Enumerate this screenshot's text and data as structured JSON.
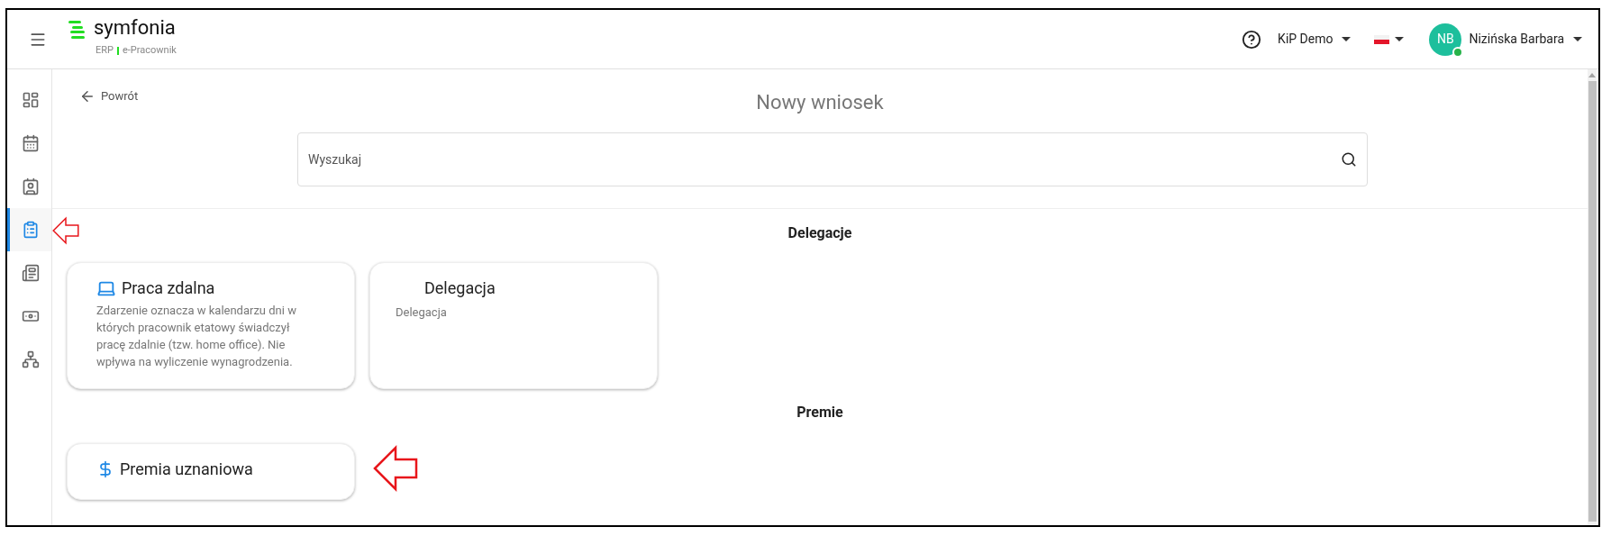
{
  "header": {
    "brand": "symfonia",
    "product_line": "ERP",
    "product": "e-Pracownik",
    "company": "KiP Demo",
    "user": {
      "initials": "NB",
      "name": "Nizińska Barbara",
      "online": true
    }
  },
  "sidebar": {
    "items": [
      {
        "kind": "dashboard",
        "selected": false
      },
      {
        "kind": "calendar",
        "selected": false
      },
      {
        "kind": "badge",
        "selected": false
      },
      {
        "kind": "clipboard",
        "selected": true
      },
      {
        "kind": "documents",
        "selected": false
      },
      {
        "kind": "money",
        "selected": false
      },
      {
        "kind": "org",
        "selected": false
      }
    ]
  },
  "page": {
    "back": "Powrót",
    "title": "Nowy wniosek",
    "search": {
      "placeholder": "Wyszukaj"
    }
  },
  "sections": [
    {
      "title": "Delegacje",
      "cards": [
        {
          "kind": "remote",
          "title": "Praca zdalna",
          "description": "Zdarzenie oznacza w kalendarzu dni w których pracownik etatowy świadczył pracę zdalnie (tzw. home office). Nie wpływa na wyliczenie wynagrodzenia."
        },
        {
          "kind": "travel",
          "title": "Delegacja",
          "description": "Delegacja"
        }
      ]
    },
    {
      "title": "Premie",
      "cards": [
        {
          "kind": "bonus",
          "title": "Premia uznaniowa"
        }
      ]
    }
  ]
}
